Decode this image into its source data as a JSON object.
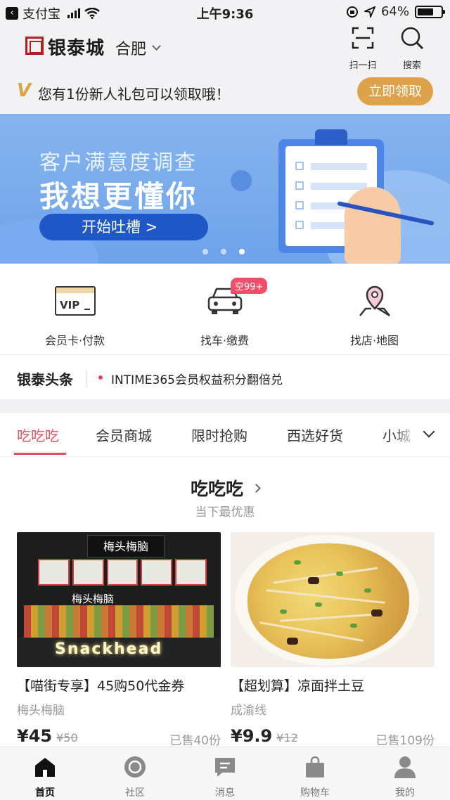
{
  "status_bar": {
    "back_app": "支付宝",
    "time": "上午9:36",
    "battery": "64%"
  },
  "header": {
    "logo": "银泰城",
    "city": "合肥",
    "scan_label": "扫一扫",
    "search_label": "搜索"
  },
  "gift_banner": {
    "icon_letter": "V",
    "text": "您有1份新人礼包可以领取哦！",
    "button": "立即领取",
    "accent": "#dda24a"
  },
  "hero": {
    "line1": "客户满意度调查",
    "line2": "我想更懂你",
    "cta": "开始吐槽 >",
    "pager_count": 3,
    "pager_active": 3
  },
  "quick_actions": [
    {
      "label": "会员卡·付款",
      "icon": "vip-card-icon",
      "card_text": "VIP"
    },
    {
      "label": "找车·缴费",
      "icon": "car-icon",
      "badge": "空99+"
    },
    {
      "label": "找店·地图",
      "icon": "map-pin-icon"
    }
  ],
  "headline": {
    "title": "银泰头条",
    "message": "INTIME365会员权益积分翻倍兑"
  },
  "tabs": [
    "吃吃吃",
    "会员商城",
    "限时抢购",
    "西选好货",
    "小城"
  ],
  "active_tab": 0,
  "section": {
    "title": "吃吃吃",
    "subtitle": "当下最优惠"
  },
  "products": [
    {
      "name": "【喵街专享】45购50代金券",
      "shop": "梅头梅脑",
      "price": "¥45",
      "original": "¥50",
      "sold": "已售40份",
      "img_sign": "梅头梅脑",
      "img_neon": "Snackhead"
    },
    {
      "name": "【超划算】凉面拌土豆",
      "shop": "成渝线",
      "price": "¥9.9",
      "original": "¥12",
      "sold": "已售109份"
    }
  ],
  "bottom_nav": [
    {
      "label": "首页",
      "icon": "home-icon"
    },
    {
      "label": "社区",
      "icon": "community-icon"
    },
    {
      "label": "消息",
      "icon": "message-icon"
    },
    {
      "label": "购物车",
      "icon": "shopping-bag-icon"
    },
    {
      "label": "我的",
      "icon": "profile-icon"
    }
  ],
  "colors": {
    "brand_red": "#b02020",
    "active_tab": "#e94a5c",
    "badge": "#f04e6a"
  }
}
